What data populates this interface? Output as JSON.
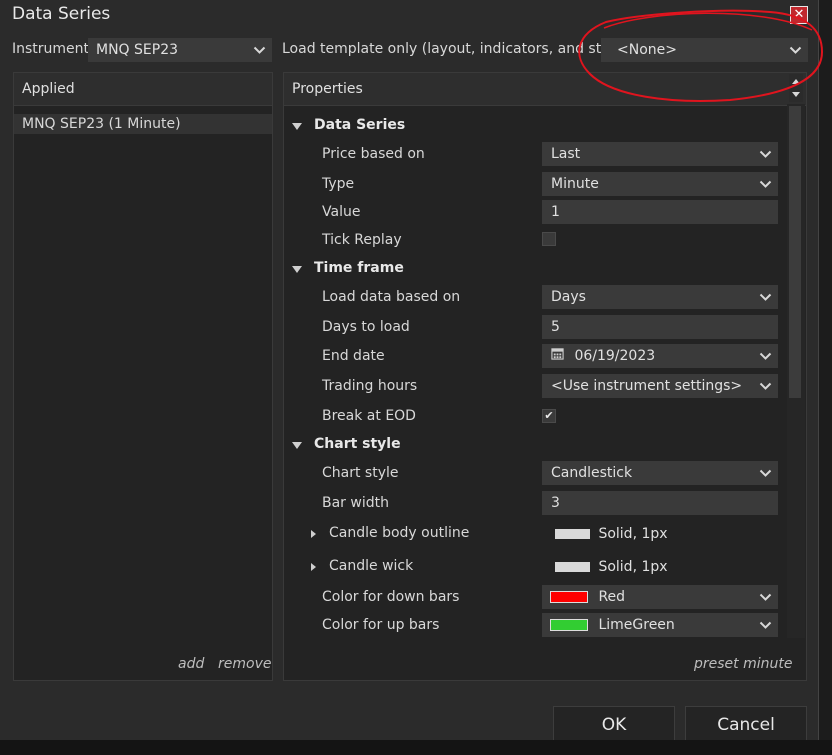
{
  "window": {
    "title": "Data Series"
  },
  "top": {
    "instrument_label": "Instrument",
    "instrument_value": "MNQ SEP23",
    "template_label": "Load template only (layout, indicators, and style)",
    "template_value": "<None>"
  },
  "applied": {
    "header": "Applied",
    "items": [
      "MNQ SEP23 (1 Minute)"
    ],
    "add_label": "add",
    "remove_label": "remove"
  },
  "properties": {
    "header": "Properties",
    "preset_label": "preset minute",
    "data_series": {
      "title": "Data Series",
      "price_based_on_label": "Price based on",
      "price_based_on_value": "Last",
      "type_label": "Type",
      "type_value": "Minute",
      "value_label": "Value",
      "value_value": "1",
      "tick_replay_label": "Tick Replay",
      "tick_replay_checked": false
    },
    "time_frame": {
      "title": "Time frame",
      "load_data_label": "Load data based on",
      "load_data_value": "Days",
      "days_to_load_label": "Days to load",
      "days_to_load_value": "5",
      "end_date_label": "End date",
      "end_date_value": "06/19/2023",
      "trading_hours_label": "Trading hours",
      "trading_hours_value": "<Use instrument settings>",
      "break_eod_label": "Break at EOD",
      "break_eod_checked": true,
      "check_glyph": "✔"
    },
    "chart_style": {
      "title": "Chart style",
      "chart_style_label": "Chart style",
      "chart_style_value": "Candlestick",
      "bar_width_label": "Bar width",
      "bar_width_value": "3",
      "candle_body_label": "Candle body outline",
      "candle_body_value": "Solid, 1px",
      "candle_wick_label": "Candle wick",
      "candle_wick_value": "Solid, 1px",
      "down_bars_label": "Color for down bars",
      "down_bars_value": "Red",
      "up_bars_label": "Color for up bars",
      "up_bars_value": "LimeGreen"
    }
  },
  "buttons": {
    "ok": "OK",
    "cancel": "Cancel"
  },
  "colors": {
    "down_bars": "#ff0000",
    "up_bars": "#32cd32",
    "stroke_swatch": "#d9d9d9",
    "annotation": "#e0141e"
  }
}
